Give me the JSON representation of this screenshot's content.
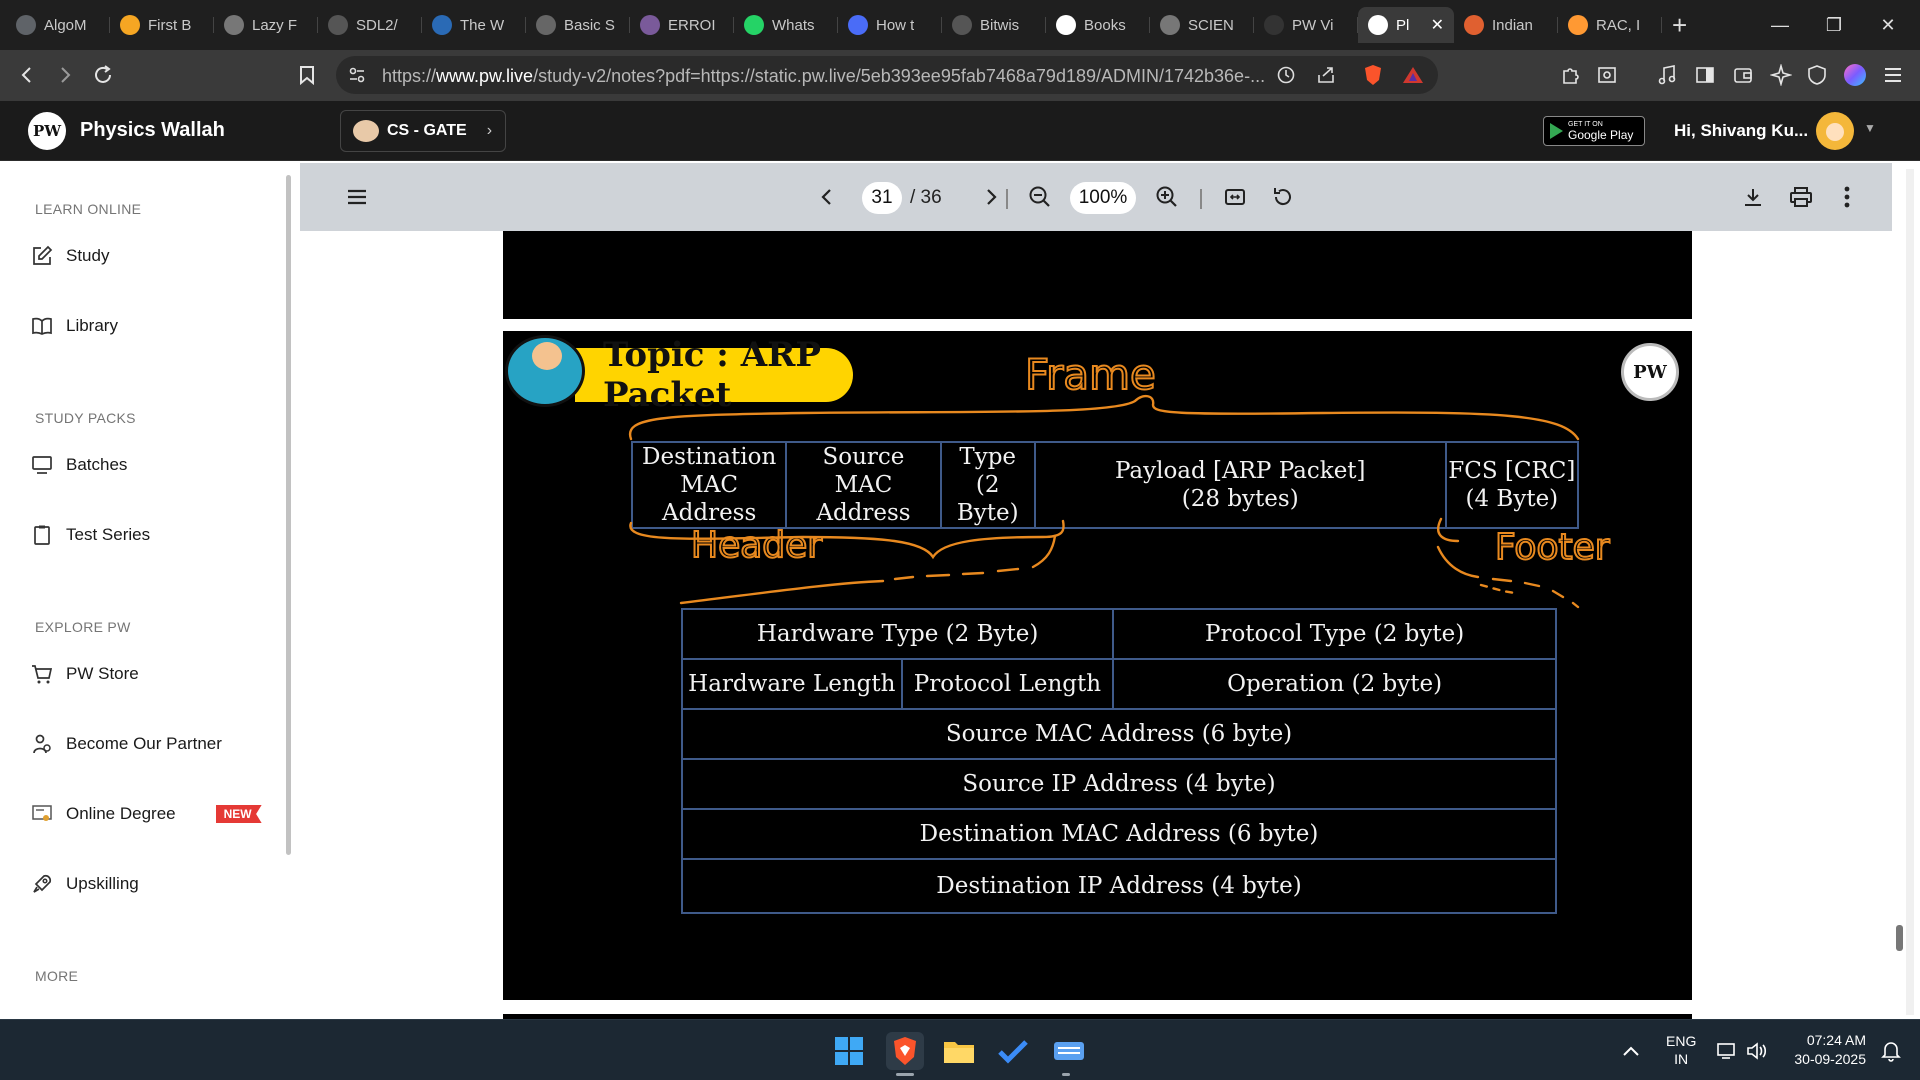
{
  "browser": {
    "tabs": [
      {
        "title": "AlgoM",
        "icon": "algo-icon",
        "color": "#5f6368"
      },
      {
        "title": "First B",
        "icon": "bolt-icon",
        "color": "#f5a623"
      },
      {
        "title": "Lazy F",
        "icon": "globe-icon",
        "color": "#777777"
      },
      {
        "title": "SDL2/",
        "icon": "github-icon",
        "color": "#555555"
      },
      {
        "title": "The W",
        "icon": "wordpress-icon",
        "color": "#2a6ab5"
      },
      {
        "title": "Basic S",
        "icon": "markdown-icon",
        "color": "#666666"
      },
      {
        "title": "ERROI",
        "icon": "error-icon",
        "color": "#7a5a9a"
      },
      {
        "title": "Whats",
        "icon": "whatsapp-icon",
        "color": "#25d366"
      },
      {
        "title": "How t",
        "icon": "bookmark-icon",
        "color": "#4a6cf7"
      },
      {
        "title": "Bitwis",
        "icon": "geeks-icon",
        "color": "#555555"
      },
      {
        "title": "Books",
        "icon": "google-icon",
        "color": "#ffffff"
      },
      {
        "title": "SCIEN",
        "icon": "globe-icon",
        "color": "#777777"
      },
      {
        "title": "PW Vi",
        "icon": "github-icon",
        "color": "#333333"
      },
      {
        "title": "Pl",
        "icon": "pw-icon",
        "color": "#ffffff",
        "active": true
      },
      {
        "title": "Indian",
        "icon": "chat-icon",
        "color": "#e06030"
      },
      {
        "title": "RAC, I",
        "icon": "flag-icon",
        "color": "#ff9933"
      }
    ],
    "url_prefix": "https://",
    "url_host": "www.pw.live",
    "url_rest": "/study-v2/notes?pdf=https://static.pw.live/5eb393ee95fab7468a79d189/ADMIN/1742b36e-..."
  },
  "header": {
    "brand": "Physics Wallah",
    "logo_text": "PW",
    "course": "CS - GATE",
    "gplay_small": "GET IT ON",
    "gplay_big": "Google Play",
    "greeting": "Hi, Shivang Ku..."
  },
  "sidebar": {
    "sections": [
      {
        "label": "LEARN ONLINE",
        "items": [
          {
            "label": "Study",
            "icon": "edit-icon"
          },
          {
            "label": "Library",
            "icon": "book-icon"
          }
        ]
      },
      {
        "label": "STUDY PACKS",
        "items": [
          {
            "label": "Batches",
            "icon": "monitor-icon"
          },
          {
            "label": "Test Series",
            "icon": "clipboard-icon"
          }
        ]
      },
      {
        "label": "EXPLORE PW",
        "items": [
          {
            "label": "PW Store",
            "icon": "cart-icon"
          },
          {
            "label": "Become Our Partner",
            "icon": "partner-icon"
          },
          {
            "label": "Online Degree",
            "icon": "degree-icon",
            "badge": "NEW"
          },
          {
            "label": "Upskilling",
            "icon": "rocket-icon"
          }
        ]
      },
      {
        "label": "MORE",
        "items": []
      }
    ]
  },
  "viewer": {
    "page_current": "31",
    "page_total": "/ 36",
    "zoom": "100%"
  },
  "slide": {
    "topic": "Topic : ARP Packet",
    "logo_text": "PW",
    "frame_fields": [
      {
        "line1": "Destination",
        "line2": "MAC Address"
      },
      {
        "line1": "Source",
        "line2": "MAC Address"
      },
      {
        "line1": "Type",
        "line2": "(2 Byte)"
      },
      {
        "line1": "Payload [ARP Packet]",
        "line2": "(28 bytes)"
      },
      {
        "line1": "FCS [CRC]",
        "line2": "(4 Byte)"
      }
    ],
    "arp_fields": {
      "hardware_type": "Hardware Type  (2 Byte)",
      "protocol_type": "Protocol Type (2 byte)",
      "hardware_length": "Hardware Length",
      "protocol_length": "Protocol Length",
      "operation": "Operation (2 byte)",
      "source_mac": "Source MAC Address (6 byte)",
      "source_ip": "Source IP Address (4 byte)",
      "dest_mac": "Destination MAC Address (6 byte)",
      "dest_ip": "Destination IP Address (4 byte)"
    },
    "annotations": {
      "frame": "Frame",
      "header": "Header",
      "footer": "Footer",
      "ink_color": "#e8891f"
    }
  },
  "taskbar": {
    "lang1": "ENG",
    "lang2": "IN",
    "time": "07:24 AM",
    "date": "30-09-2025"
  }
}
